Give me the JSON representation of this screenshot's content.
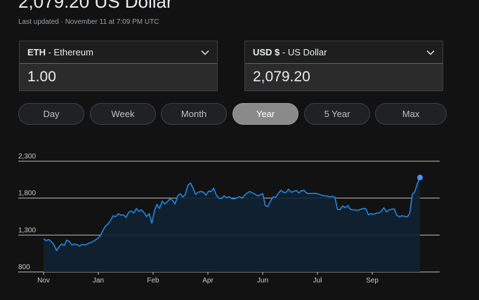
{
  "header": {
    "headline": "2,079.20 US Dollar",
    "updated": "Last updated · November 11 at 7:09 PM UTC"
  },
  "from": {
    "code": "ETH",
    "name": " - Ethereum",
    "value": "1.00"
  },
  "to": {
    "code": "USD $",
    "name": " - US Dollar",
    "value": "2,079.20"
  },
  "ranges": [
    {
      "label": "Day",
      "active": false
    },
    {
      "label": "Week",
      "active": false
    },
    {
      "label": "Month",
      "active": false
    },
    {
      "label": "Year",
      "active": true
    },
    {
      "label": "5 Year",
      "active": false
    },
    {
      "label": "Max",
      "active": false
    }
  ],
  "colors": {
    "line": "#1e88e5",
    "fill": "#122233",
    "point": "#4d90fe",
    "grid": "#bdbdbd"
  },
  "chart_data": {
    "type": "area",
    "x_labels": [
      "Nov",
      "Jan",
      "Feb",
      "Apr",
      "Jun",
      "Jul",
      "Sep"
    ],
    "y_ticks": [
      "2,300",
      "1,800",
      "1,300",
      "800"
    ],
    "ylim": [
      800,
      2300
    ],
    "grid": true,
    "values": [
      1250,
      1225,
      1240,
      1210,
      1170,
      1090,
      1140,
      1180,
      1160,
      1230,
      1215,
      1165,
      1180,
      1170,
      1150,
      1175,
      1165,
      1180,
      1195,
      1210,
      1230,
      1255,
      1290,
      1360,
      1420,
      1450,
      1500,
      1560,
      1550,
      1590,
      1570,
      1575,
      1540,
      1610,
      1625,
      1600,
      1660,
      1620,
      1640,
      1600,
      1550,
      1590,
      1460,
      1630,
      1715,
      1660,
      1760,
      1720,
      1750,
      1790,
      1770,
      1720,
      1830,
      1860,
      1815,
      1850,
      1975,
      2005,
      1935,
      1850,
      1880,
      1890,
      1880,
      1840,
      1895,
      1890,
      1935,
      1840,
      1800,
      1795,
      1830,
      1805,
      1820,
      1795,
      1790,
      1805,
      1820,
      1800,
      1840,
      1870,
      1890,
      1870,
      1855,
      1830,
      1845,
      1860,
      1700,
      1685,
      1760,
      1815,
      1810,
      1860,
      1905,
      1880,
      1875,
      1920,
      1880,
      1890,
      1905,
      1870,
      1900,
      1905,
      1870,
      1860,
      1865,
      1865,
      1860,
      1850,
      1840,
      1830,
      1830,
      1815,
      1825,
      1810,
      1650,
      1645,
      1695,
      1670,
      1700,
      1650,
      1640,
      1640,
      1635,
      1650,
      1660,
      1655,
      1575,
      1590,
      1580,
      1595,
      1600,
      1620,
      1670,
      1615,
      1640,
      1650,
      1655,
      1565,
      1550,
      1560,
      1555,
      1545,
      1590,
      1845,
      1890,
      2000,
      2079
    ]
  }
}
